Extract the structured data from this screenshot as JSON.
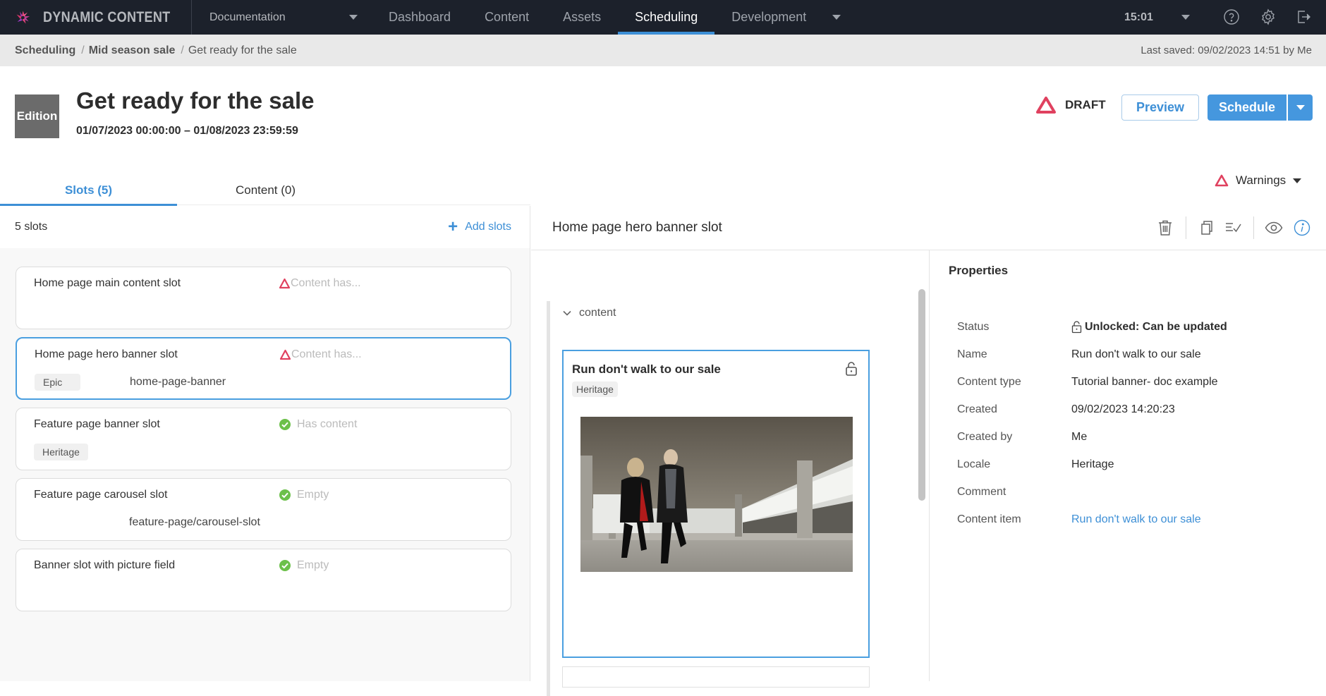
{
  "app": {
    "name": "DYNAMIC CONTENT",
    "hub": "Documentation",
    "nav": [
      {
        "label": "Dashboard",
        "active": false
      },
      {
        "label": "Content",
        "active": false
      },
      {
        "label": "Assets",
        "active": false
      },
      {
        "label": "Scheduling",
        "active": true
      },
      {
        "label": "Development",
        "active": false
      }
    ],
    "clock": "15:01",
    "icons": [
      "help-icon",
      "settings-icon",
      "logout-icon"
    ]
  },
  "breadcrumb": {
    "items": [
      "Scheduling",
      "Mid season sale",
      "Get ready for the sale"
    ],
    "separator": "/",
    "last_saved": "Last saved: 09/02/2023 14:51 by Me"
  },
  "edition": {
    "badge": "Edition",
    "title": "Get ready for the sale",
    "dates": "01/07/2023 00:00:00  –  01/08/2023 23:59:59",
    "status": "DRAFT",
    "preview_label": "Preview",
    "schedule_label": "Schedule"
  },
  "tabs": [
    {
      "label": "Slots (5)",
      "active": true
    },
    {
      "label": "Content (0)",
      "active": false
    }
  ],
  "warnings_label": "Warnings",
  "slots": {
    "count_label": "5 slots",
    "add_label": "Add slots",
    "items": [
      {
        "name": "Home page main content slot",
        "status": "Content has...",
        "status_type": "warning",
        "locale": "",
        "key": "",
        "selected": false
      },
      {
        "name": "Home page hero banner slot",
        "status": "Content has...",
        "status_type": "warning",
        "locale": "Epic",
        "key": "home-page-banner",
        "selected": true
      },
      {
        "name": "Feature page banner slot",
        "status": "Has content",
        "status_type": "ok",
        "locale": "Heritage",
        "key": "",
        "selected": false
      },
      {
        "name": "Feature page carousel slot",
        "status": "Empty",
        "status_type": "ok",
        "locale": "",
        "key": "feature-page/carousel-slot",
        "selected": false
      },
      {
        "name": "Banner slot with picture field",
        "status": "Empty",
        "status_type": "ok",
        "locale": "",
        "key": "",
        "selected": false
      }
    ]
  },
  "detail": {
    "title": "Home page hero banner slot",
    "toolbar": [
      "delete-icon",
      "copy-icon",
      "validate-icon",
      "preview-icon",
      "info-icon"
    ],
    "content_toggle": "content",
    "card": {
      "title": "Run don't walk to our sale",
      "locale": "Heritage",
      "image_alt": "Two people running under a concrete bridge"
    }
  },
  "properties": {
    "title": "Properties",
    "rows": [
      {
        "label": "Status",
        "value": "Unlocked: Can be updated",
        "style": "bold",
        "icon": "unlock-icon"
      },
      {
        "label": "Name",
        "value": "Run don't walk to our sale",
        "style": "normal"
      },
      {
        "label": "Content type",
        "value": "Tutorial banner- doc example",
        "style": "normal"
      },
      {
        "label": "Created",
        "value": "09/02/2023 14:20:23",
        "style": "normal"
      },
      {
        "label": "Created by",
        "value": "Me",
        "style": "normal"
      },
      {
        "label": "Locale",
        "value": "Heritage",
        "style": "normal"
      },
      {
        "label": "Comment",
        "value": "",
        "style": "normal"
      },
      {
        "label": "Content item",
        "value": "Run don't walk to our sale",
        "style": "link"
      }
    ]
  },
  "colors": {
    "accent": "#3d8fd6",
    "nav_bg": "#1c212b",
    "warning": "#e0415f",
    "ok": "#6cc04a"
  }
}
